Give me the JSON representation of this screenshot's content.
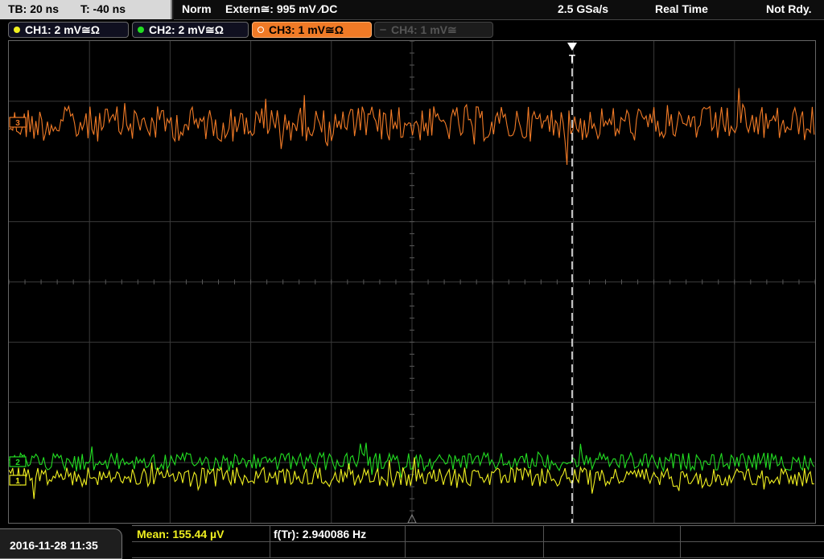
{
  "timebase": {
    "tb_label": "TB: 20 ns",
    "t_label": "T: -40 ns"
  },
  "status": {
    "mode": "Norm",
    "trigger": "Extern≅: 995 mV ⁄DC",
    "sample_rate": "2.5 GSa/s",
    "acq_mode": "Real Time",
    "state": "Not Rdy."
  },
  "channels": [
    {
      "label": "CH1: 2 mV≅Ω",
      "color": "#f0f020",
      "state": "on"
    },
    {
      "label": "CH2: 2 mV≅Ω",
      "color": "#22dd22",
      "state": "on"
    },
    {
      "label": "CH3: 1 mV≅Ω",
      "color": "#f07a26",
      "state": "selected"
    },
    {
      "label": "CH4: 1 mV≅",
      "color": "#555555",
      "state": "off"
    }
  ],
  "markers": {
    "trigger_label": "T",
    "ch3_ref": "3",
    "ch2_ref": "2",
    "ch1_ref": "1"
  },
  "waveform_colors": {
    "ch1": "#f0f020",
    "ch2": "#22dd22",
    "ch3": "#f07a26"
  },
  "footer": {
    "datetime": "2016-11-28 11:35",
    "mean_label": "Mean: 155.44 µV",
    "freq_label": "f(Tr): 2.940086 Hz"
  }
}
